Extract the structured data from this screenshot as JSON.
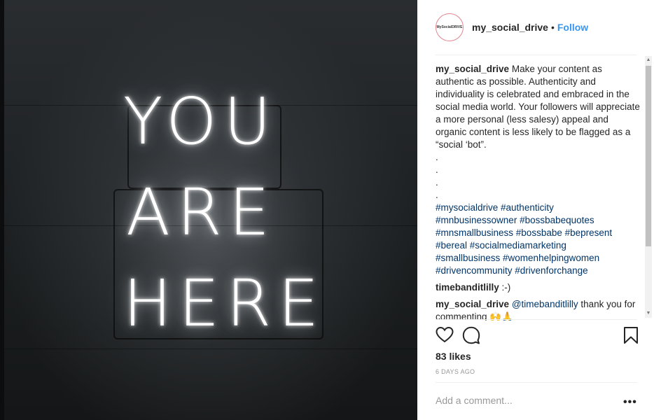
{
  "image": {
    "neon_lines": [
      "YOU",
      "ARE",
      "HERE"
    ]
  },
  "post": {
    "username": "my_social_drive",
    "follow_label": "Follow",
    "separator": "•",
    "avatar_text": "MySocialDRIVE",
    "caption": {
      "username": "my_social_drive",
      "text": "Make your content as authentic as possible. Authenticity and individuality is celebrated and embraced in the social media world. Your followers will appreciate a more personal (less salesy) appeal and organic content is less likely to be flagged as a “social ‘bot”.",
      "dots": [
        ".",
        ".",
        ".",
        "."
      ],
      "hashtag_lines": [
        "#mysocialdrive #authenticity",
        "#mnbusinessowner #bossbabequotes",
        "#mnsmallbusiness #bossbabe #bepresent",
        "#bereal #socialmediamarketing",
        "#smallbusiness #womenhelpingwomen",
        "#drivencommunity #drivenforchange"
      ]
    },
    "comments": [
      {
        "username": "timebanditlilly",
        "text": ":-)"
      },
      {
        "username": "my_social_drive",
        "mention": "@timebanditlilly",
        "text": "thank you for commenting 🙌🙏"
      }
    ],
    "likes_text": "83 likes",
    "time_ago": "6 DAYS AGO",
    "comment_placeholder": "Add a comment...",
    "more_label": "•••"
  },
  "icons": {
    "like": "heart-icon",
    "comment": "comment-bubble-icon",
    "save": "bookmark-icon"
  }
}
